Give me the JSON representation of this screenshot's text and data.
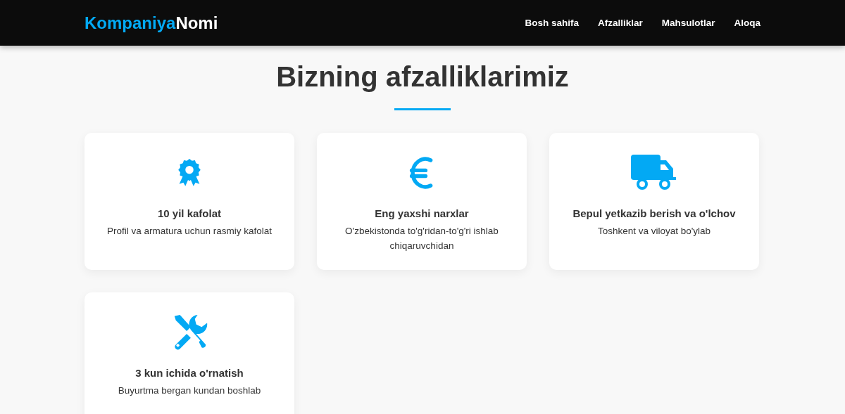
{
  "header": {
    "logo": {
      "first": "Kompaniya",
      "second": "Nomi"
    },
    "nav": [
      {
        "label": "Bosh sahifa"
      },
      {
        "label": "Afzalliklar"
      },
      {
        "label": "Mahsulotlar"
      },
      {
        "label": "Aloqa"
      }
    ]
  },
  "section": {
    "title": "Bizning afzalliklarimiz",
    "cards": [
      {
        "kind": "award",
        "title": "10 yil kafolat",
        "text": "Profil va armatura uchun rasmiy kafolat"
      },
      {
        "kind": "euro",
        "title": "Eng yaxshi narxlar",
        "text": "O'zbekistonda to'g'ridan-to'g'ri ishlab chiqaruvchidan"
      },
      {
        "kind": "truck",
        "title": "Bepul yetkazib berish va o'lchov",
        "text": "Toshkent va viloyat bo'ylab"
      },
      {
        "kind": "tools",
        "title": "3 kun ichida o'rnatish",
        "text": "Buyurtma bergan kundan boshlab"
      }
    ]
  }
}
